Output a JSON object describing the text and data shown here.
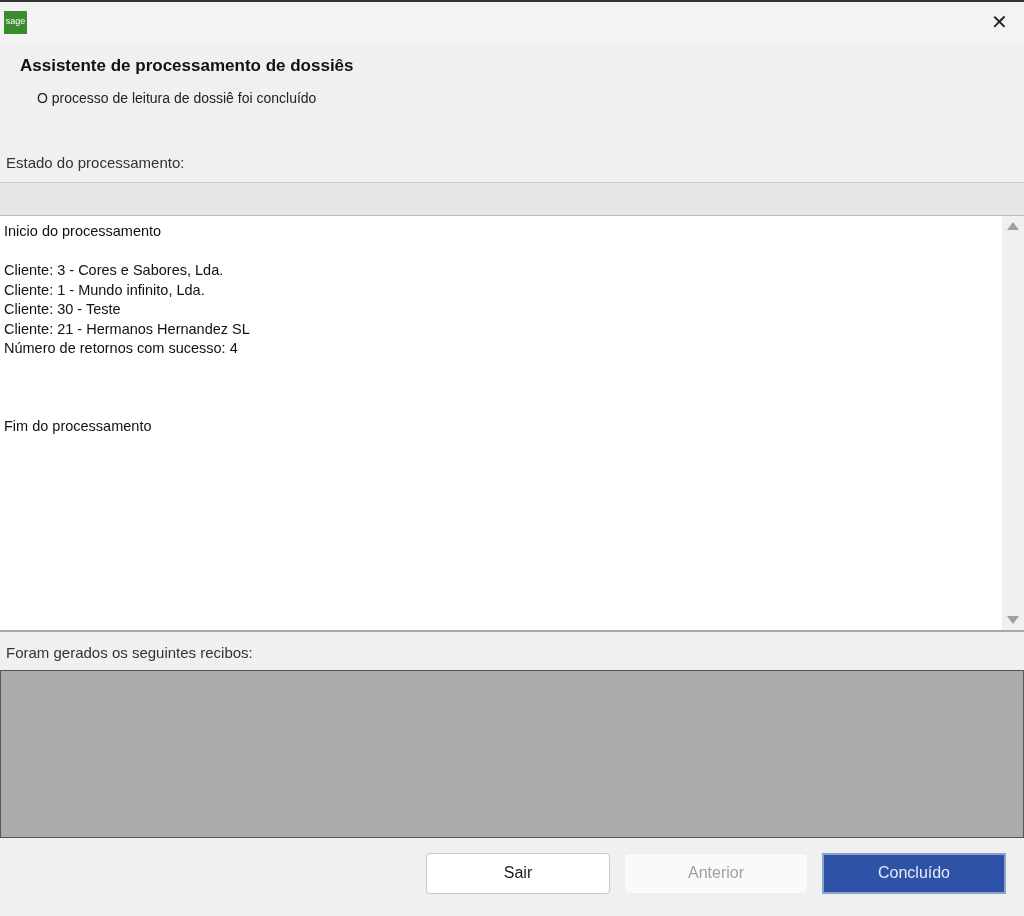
{
  "window": {
    "logo_text": "sage",
    "close": "✕"
  },
  "header": {
    "title": "Assistente de processamento de dossiês",
    "subtitle": "O processo de leitura de dossiê foi concluído"
  },
  "status": {
    "label": "Estado do processamento:",
    "level": 0
  },
  "log": {
    "groups": [
      {
        "lines": [
          "Inicio do processamento"
        ]
      },
      {
        "lines": [
          "Cliente: 3 - Cores e Sabores, Lda.",
          "Cliente: 1 - Mundo infinito, Lda.",
          "Cliente: 30 - Teste",
          "Cliente: 21 - Hermanos Hernandez SL",
          "Número de retornos com sucesso: 4"
        ]
      },
      {
        "lines": [
          "Fim do processamento"
        ]
      }
    ]
  },
  "receipts": {
    "label": "Foram gerados os seguintes recibos:"
  },
  "buttons": [
    {
      "label": "Sair",
      "kind": "default",
      "disabled": false
    },
    {
      "label": "Anterior",
      "kind": "default",
      "disabled": true
    },
    {
      "label": "Concluído",
      "kind": "primary",
      "disabled": false
    }
  ]
}
